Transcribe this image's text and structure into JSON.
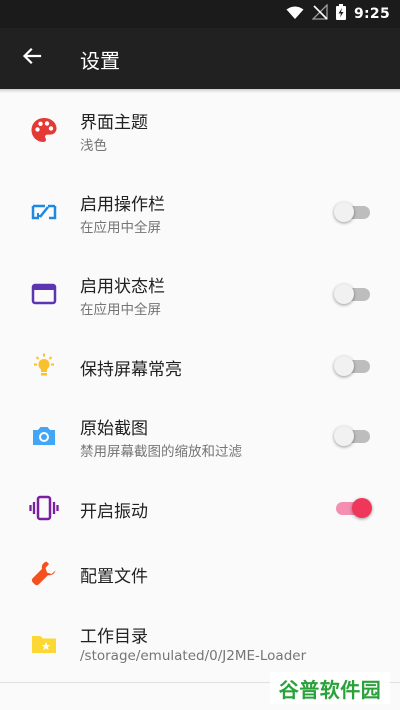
{
  "status_bar": {
    "time": "9:25",
    "icons": [
      "wifi-icon",
      "no-signal-icon",
      "battery-charging-icon"
    ]
  },
  "app_bar": {
    "title": "设置",
    "back_icon": "arrow-back-icon"
  },
  "settings": [
    {
      "id": "theme",
      "title": "界面主题",
      "subtitle": "浅色",
      "icon": "palette-icon",
      "icon_color": "#e53935"
    },
    {
      "id": "actionbar",
      "title": "启用操作栏",
      "subtitle": "在应用中全屏",
      "icon": "fullscreen-toggle-icon",
      "icon_color": "#1e88e5",
      "toggle": "off"
    },
    {
      "id": "statusbar",
      "title": "启用状态栏",
      "subtitle": "在应用中全屏",
      "icon": "window-icon",
      "icon_color": "#5e35b1",
      "toggle": "off"
    },
    {
      "id": "screen-on",
      "title": "保持屏幕常亮",
      "icon": "lightbulb-icon",
      "icon_color": "#fbc02d",
      "toggle": "off"
    },
    {
      "id": "screenshot",
      "title": "原始截图",
      "subtitle": "禁用屏幕截图的缩放和过滤",
      "icon": "camera-icon",
      "icon_color": "#42a5f5",
      "toggle": "off"
    },
    {
      "id": "vibration",
      "title": "开启振动",
      "icon": "vibration-icon",
      "icon_color": "#7b1fa2",
      "toggle": "on"
    },
    {
      "id": "profiles",
      "title": "配置文件",
      "icon": "wrench-icon",
      "icon_color": "#f4511e"
    },
    {
      "id": "workdir",
      "title": "工作目录",
      "subtitle": "/storage/emulated/0/J2ME-Loader",
      "icon": "folder-star-icon",
      "icon_color": "#fdd835"
    }
  ],
  "watermark": {
    "text": "谷普软件园"
  },
  "colors": {
    "appbar": "#212121",
    "statusbar": "#1b1b1b",
    "accent": "#f0365a",
    "background": "#fafafa"
  }
}
